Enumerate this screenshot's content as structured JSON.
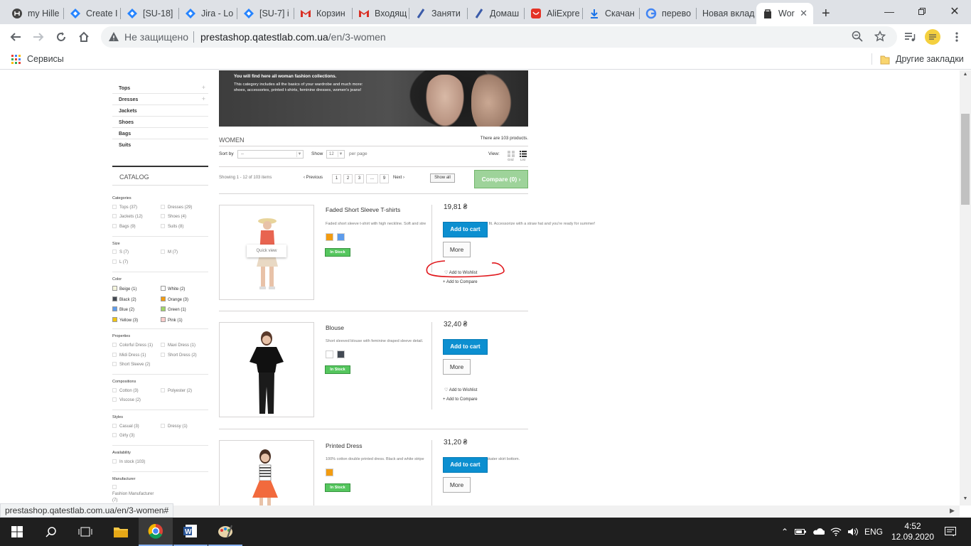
{
  "browser": {
    "tabs": [
      {
        "title": "my Hille",
        "icon": "hillel-icon"
      },
      {
        "title": "Create I",
        "icon": "jira-icon"
      },
      {
        "title": "[SU-18]",
        "icon": "jira-icon"
      },
      {
        "title": "Jira - Lo",
        "icon": "jira-icon"
      },
      {
        "title": "[SU-7] i",
        "icon": "jira-icon"
      },
      {
        "title": "Корзин",
        "icon": "gmail-icon"
      },
      {
        "title": "Входящ",
        "icon": "gmail-icon"
      },
      {
        "title": "Заняти",
        "icon": "lms-icon"
      },
      {
        "title": "Домаш",
        "icon": "lms-icon"
      },
      {
        "title": "AliExpre",
        "icon": "aliexpress-icon"
      },
      {
        "title": "Скачан",
        "icon": "download-icon"
      },
      {
        "title": "перево",
        "icon": "google-icon"
      },
      {
        "title": "Новая вклад",
        "icon": ""
      },
      {
        "title": "Wor",
        "icon": "bag-icon"
      }
    ],
    "new_tab": "+",
    "address": {
      "security": "Не защищено",
      "host": "prestashop.qatestlab.com.ua",
      "path": "/en/3-women"
    },
    "bookmarks": {
      "apps": "Сервисы",
      "other": "Другие закладки"
    },
    "status_url": "prestashop.qatestlab.com.ua/en/3-women#"
  },
  "sidebar": {
    "subcategories": [
      {
        "label": "Tops",
        "expandable": true
      },
      {
        "label": "Dresses",
        "expandable": true
      },
      {
        "label": "Jackets",
        "expandable": false
      },
      {
        "label": "Shoes",
        "expandable": false
      },
      {
        "label": "Bags",
        "expandable": false
      },
      {
        "label": "Suits",
        "expandable": false
      }
    ],
    "plus": "+",
    "catalog_title": "CATALOG",
    "filters": {
      "categories": {
        "title": "Categories",
        "items": [
          "Tops (37)",
          "Dresses (29)",
          "Jackets (12)",
          "Shoes (4)",
          "Bags (9)",
          "Suits (8)"
        ]
      },
      "size": {
        "title": "Size",
        "items": [
          "S (7)",
          "M (7)",
          "L (7)"
        ]
      },
      "color": {
        "title": "Color",
        "items": [
          {
            "label": "Beige (1)",
            "color": "#f5f5dc"
          },
          {
            "label": "White (2)",
            "color": "#ffffff"
          },
          {
            "label": "Black (2)",
            "color": "#434a54"
          },
          {
            "label": "Orange (3)",
            "color": "#f39c11"
          },
          {
            "label": "Blue (2)",
            "color": "#5d9cec"
          },
          {
            "label": "Green (1)",
            "color": "#a0d468"
          },
          {
            "label": "Yellow (3)",
            "color": "#f1c40f"
          },
          {
            "label": "Pink (1)",
            "color": "#fcccca"
          }
        ]
      },
      "properties": {
        "title": "Properties",
        "items": [
          "Colorful Dress (1)",
          "Maxi Dress (1)",
          "Midi Dress (1)",
          "Short Dress (2)",
          "Short Sleeve (2)"
        ]
      },
      "compositions": {
        "title": "Compositions",
        "items": [
          "Cotton (3)",
          "Polyester (2)",
          "Viscose (2)"
        ]
      },
      "styles": {
        "title": "Styles",
        "items": [
          "Casual (3)",
          "Dressy (1)",
          "Girly (3)"
        ]
      },
      "availability": {
        "title": "Availability",
        "items": [
          "In stock (103)"
        ]
      },
      "manufacturer": {
        "title": "Manufacturer",
        "items": [
          "Fashion Manufacturer",
          "(7)"
        ]
      }
    }
  },
  "main": {
    "banner": {
      "line1": "You will find here all woman fashion collections.",
      "line2": "This category includes all the basics of your wardrobe and much more:",
      "line3": "shoes, accessories, printed t-shirts, feminine dresses, women's jeans!"
    },
    "heading": "WOMEN",
    "product_count": "There are 103 products.",
    "sort_label": "Sort by",
    "sort_value": "--",
    "show_label": "Show",
    "show_value": "12",
    "per_page": "per page",
    "view_label": "View:",
    "view_grid": "Grid",
    "view_list": "List",
    "showing": "Showing 1 - 12 of 103 items",
    "pagination": {
      "previous": "Previous",
      "pages": [
        "1",
        "2",
        "3",
        "...",
        "9"
      ],
      "next": "Next"
    },
    "show_all": "Show all",
    "compare": "Compare (0)",
    "products": [
      {
        "name": "Faded Short Sleeve T-shirts",
        "desc_left": "Faded short sleeve t-shirt with high neckline. Soft and stre",
        "desc_right": "mfortable fit. Accessorize with a straw hat and you're ready for summer!",
        "price": "19,81 ₴",
        "colors": [
          "#f39c11",
          "#5d9cec"
        ],
        "stock": "In Stock",
        "add_to_cart": "Add to cart",
        "more": "More",
        "wishlist": "Add to Wishlist",
        "compare": "Add to Compare",
        "quick_view": "Quick view"
      },
      {
        "name": "Blouse",
        "desc_left": "Short sleeved blouse with feminine draped sleeve detail.",
        "desc_right": "",
        "price": "32,40 ₴",
        "colors": [
          "#ffffff",
          "#434a54"
        ],
        "stock": "In Stock",
        "add_to_cart": "Add to cart",
        "more": "More",
        "wishlist": "Add to Wishlist",
        "compare": "Add to Compare"
      },
      {
        "name": "Printed Dress",
        "desc_left": "100% cotton double printed dress. Black and white stripe",
        "desc_right": "waisted skater skirt bottom.",
        "price": "31,20 ₴",
        "colors": [
          "#f39c11"
        ],
        "stock": "In Stock",
        "add_to_cart": "Add to cart",
        "more": "More"
      }
    ]
  },
  "taskbar": {
    "lang": "ENG",
    "time": "4:52",
    "date": "12.09.2020"
  },
  "colors": {
    "annotation": "#e0161b",
    "cart_blue": "#0c8fd0",
    "stock_green": "#55c65e"
  }
}
